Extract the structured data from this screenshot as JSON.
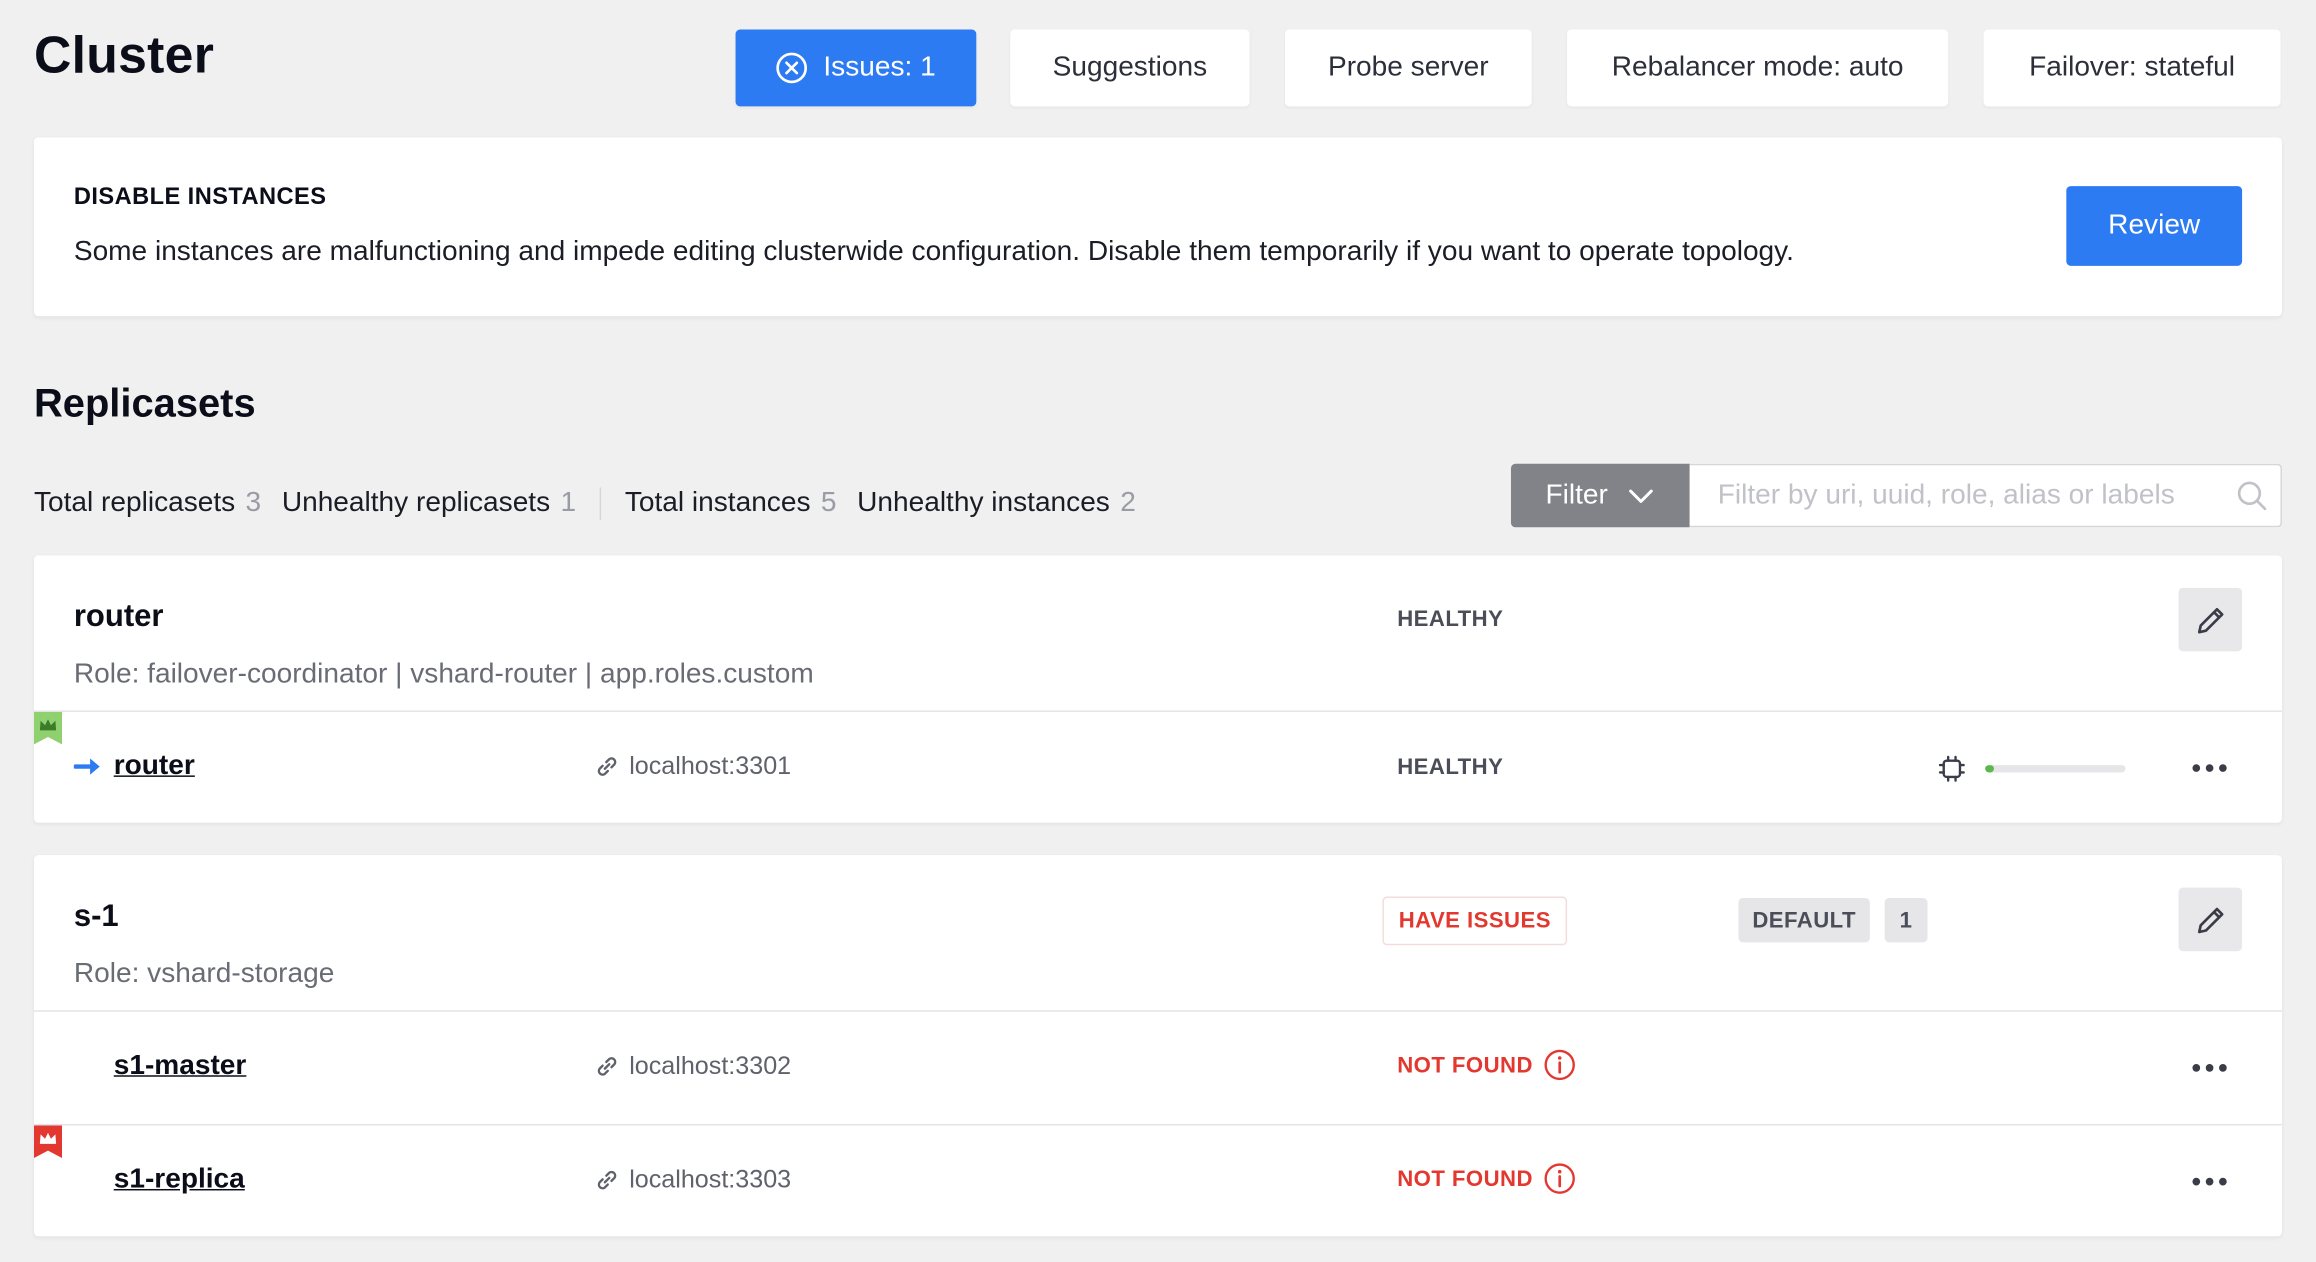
{
  "header": {
    "title": "Cluster",
    "buttons": {
      "issues": "Issues: 1",
      "suggestions": "Suggestions",
      "probe": "Probe server",
      "rebalancer": "Rebalancer mode: auto",
      "failover": "Failover: stateful"
    }
  },
  "issue_banner": {
    "title": "DISABLE INSTANCES",
    "text": "Some instances are malfunctioning and impede editing clusterwide configuration. Disable them temporarily if you want to operate topology.",
    "action": "Review"
  },
  "replicasets": {
    "title": "Replicasets",
    "stats": {
      "total_replicasets_label": "Total replicasets",
      "total_replicasets": "3",
      "unhealthy_replicasets_label": "Unhealthy replicasets",
      "unhealthy_replicasets": "1",
      "total_instances_label": "Total instances",
      "total_instances": "5",
      "unhealthy_instances_label": "Unhealthy instances",
      "unhealthy_instances": "2"
    },
    "filter": {
      "button_label": "Filter",
      "placeholder": "Filter by uri, uuid, role, alias or labels",
      "value": ""
    },
    "items": [
      {
        "name": "router",
        "role": "Role: failover-coordinator | vshard-router | app.roles.custom",
        "status": "HEALTHY",
        "instances": [
          {
            "name": "router",
            "uri": "localhost:3301",
            "status": "HEALTHY",
            "leader": true,
            "memory_usage_fraction": 0.03
          }
        ]
      },
      {
        "name": "s-1",
        "role": "Role: vshard-storage",
        "status": "HAVE ISSUES",
        "vshard_group": "DEFAULT",
        "weight": "1",
        "instances": [
          {
            "name": "s1-master",
            "uri": "localhost:3302",
            "status": "NOT FOUND"
          },
          {
            "name": "s1-replica",
            "uri": "localhost:3303",
            "status": "NOT FOUND",
            "leader": true
          }
        ]
      }
    ]
  },
  "colors": {
    "primary": "#2d7bf2",
    "danger": "#e3382f",
    "healthy_leader": "#8fd16f",
    "unhealthy_leader": "#e3382f",
    "memory_bar": "#5ab94b"
  },
  "icons": {
    "issues": "x-circle-icon",
    "filter": "chevron-down-icon",
    "search": "search-icon",
    "edit": "pencil-icon",
    "link": "link-icon",
    "arrow": "arrow-right-icon",
    "leader": "crown-icon",
    "cpu": "cpu-icon",
    "info": "info-icon",
    "more": "more-icon"
  }
}
